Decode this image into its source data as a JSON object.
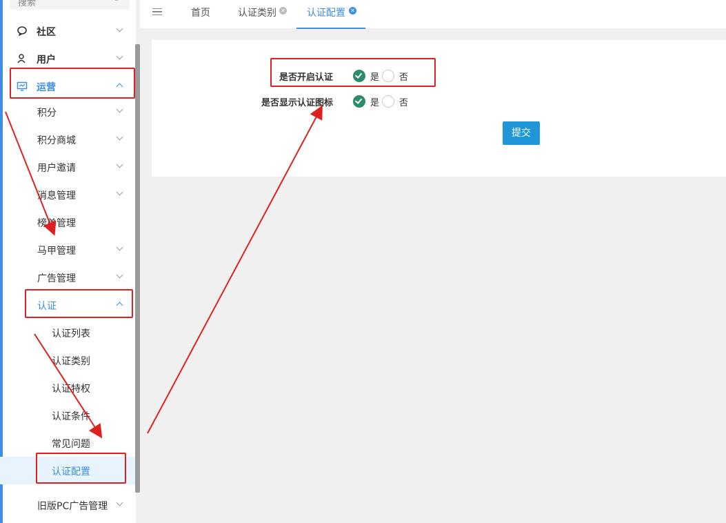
{
  "sidebar": {
    "search_placeholder": "搜索",
    "items": [
      {
        "label": "社区",
        "icon": "chat-icon"
      },
      {
        "label": "用户",
        "icon": "users-icon"
      },
      {
        "label": "运营",
        "icon": "monitor-icon"
      },
      {
        "label": "积分"
      },
      {
        "label": "积分商城"
      },
      {
        "label": "用户邀请"
      },
      {
        "label": "消息管理"
      },
      {
        "label": "榜单管理"
      },
      {
        "label": "马甲管理"
      },
      {
        "label": "广告管理"
      },
      {
        "label": "认证"
      },
      {
        "label": "认证列表"
      },
      {
        "label": "认证类别"
      },
      {
        "label": "认证特权"
      },
      {
        "label": "认证条件"
      },
      {
        "label": "常见问题"
      },
      {
        "label": "认证配置"
      },
      {
        "label": "旧版PC广告管理"
      }
    ]
  },
  "tabs": [
    {
      "label": "首页"
    },
    {
      "label": "认证类别"
    },
    {
      "label": "认证配置"
    }
  ],
  "form": {
    "rows": [
      {
        "label": "是否开启认证",
        "yes": "是",
        "no": "否",
        "selected": "是"
      },
      {
        "label": "是否显示认证图标",
        "yes": "是",
        "no": "否",
        "selected": "是"
      }
    ],
    "submit_label": "提交"
  },
  "colors": {
    "accent": "#3d8ee0",
    "radio_checked": "#2e8b6d",
    "button": "#1e96d8",
    "annotation": "#e02020"
  }
}
